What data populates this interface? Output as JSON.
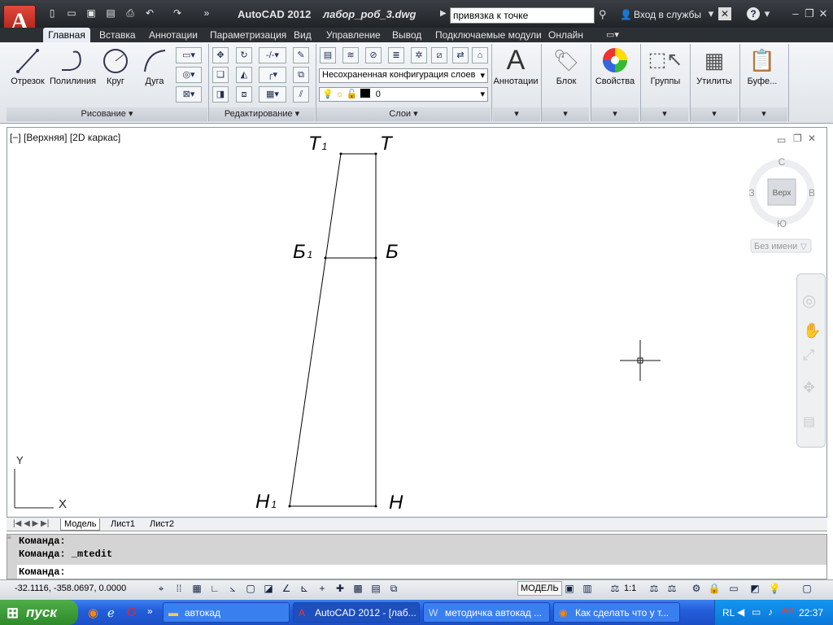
{
  "titlebar": {
    "app_name": "AutoCAD 2012",
    "file_name": "лабор_роб_3.dwg",
    "search_value": "привязка к точке",
    "signin_label": "Вход в службы"
  },
  "ribbon_tabs": [
    "Главная",
    "Вставка",
    "Аннотации",
    "Параметризация",
    "Вид",
    "Управление",
    "Вывод",
    "Подключаемые модули",
    "Онлайн"
  ],
  "draw_panel": {
    "tools": [
      "Отрезок",
      "Полилиния",
      "Круг",
      "Дуга"
    ],
    "footer": "Рисование"
  },
  "modify_panel": {
    "footer": "Редактирование"
  },
  "layers_panel": {
    "layer_state": "Несохраненная конфигурация слоев",
    "current_layer": "0",
    "footer": "Слои"
  },
  "big_tools": [
    "Аннотации",
    "Блок",
    "Свойства",
    "Группы",
    "Утилиты",
    "Буфе..."
  ],
  "viewport": {
    "label": "[−] [Верхняя] [2D каркас]",
    "viewcube": {
      "north": "С",
      "south": "Ю",
      "east": "В",
      "west": "З",
      "face": "Верх",
      "ucs": "Без имени"
    },
    "points": {
      "T1": {
        "main": "Т",
        "sub": "1"
      },
      "T": {
        "main": "Т"
      },
      "B1": {
        "main": "Б",
        "sub": "1"
      },
      "B": {
        "main": "Б"
      },
      "H1": {
        "main": "Н",
        "sub": "1"
      },
      "H": {
        "main": "Н"
      }
    },
    "ucs_x": "X",
    "ucs_y": "Y"
  },
  "layout_tabs": [
    "Модель",
    "Лист1",
    "Лист2"
  ],
  "command": {
    "line1": "Команда:",
    "line2": "Команда: _mtedit",
    "prompt": "Команда:"
  },
  "statusbar": {
    "coords": "-32.1116, -358.0697, 0.0000",
    "model_label": "МОДЕЛЬ",
    "scale": "1:1"
  },
  "taskbar": {
    "start_label": "пуск",
    "tasks": [
      "автокад",
      "AutoCAD 2012 - [лаб...",
      "методичка автокад ...",
      "Как сделать что у т..."
    ],
    "lang": "RL",
    "clock": "22:37"
  }
}
